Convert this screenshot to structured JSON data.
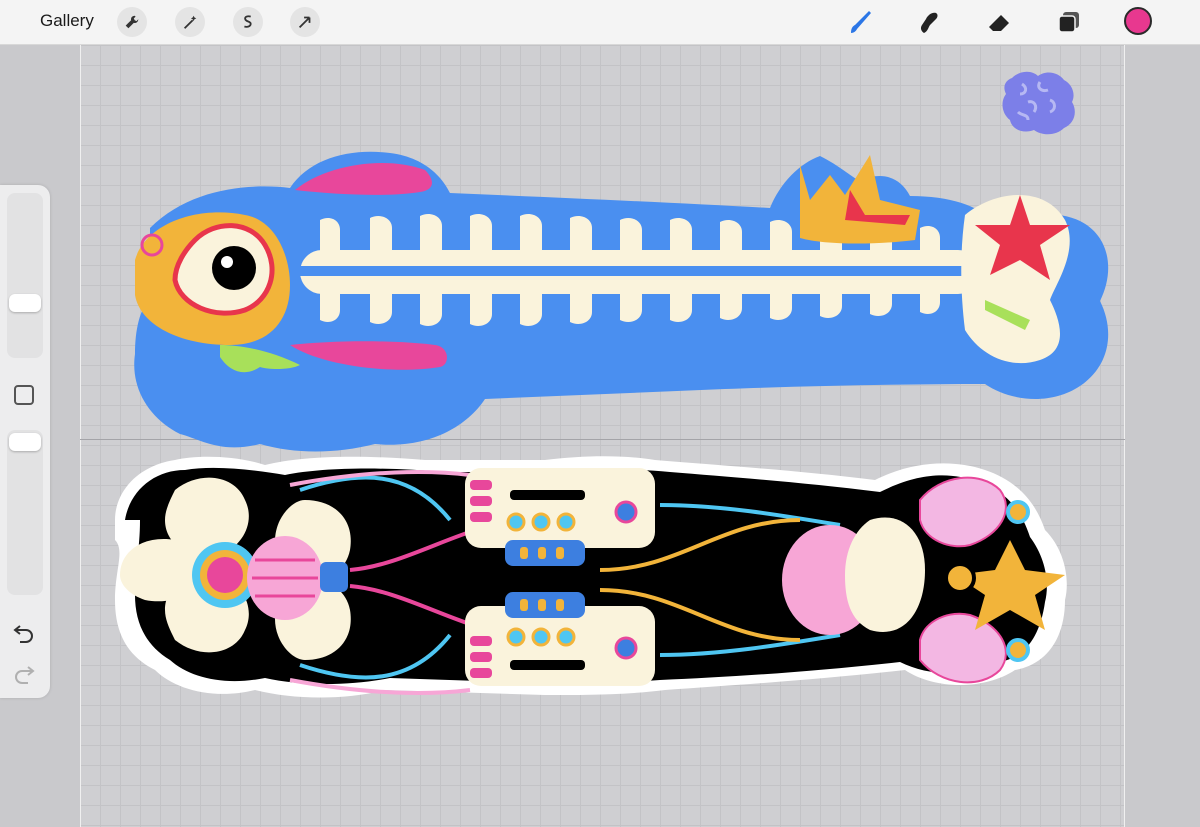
{
  "toolbar": {
    "gallery_label": "Gallery",
    "left_tools": [
      "wrench-icon",
      "magic-wand-icon",
      "selection-icon",
      "transform-arrow-icon"
    ],
    "right_tools": [
      "brush-icon",
      "smudge-icon",
      "eraser-icon",
      "layers-icon"
    ],
    "current_color": "#e8388f"
  },
  "sidebar": {
    "brush_size": 0.45,
    "opacity": 0.05,
    "modify_button": "square-modify-icon",
    "undo": "undo-icon",
    "redo": "redo-icon"
  },
  "palette": {
    "blue": "#4a8ff0",
    "orange": "#f2b43a",
    "pink": "#e8479b",
    "cream": "#faf3dc",
    "red": "#e8354c",
    "black": "#000000",
    "lime": "#a8e05a"
  }
}
